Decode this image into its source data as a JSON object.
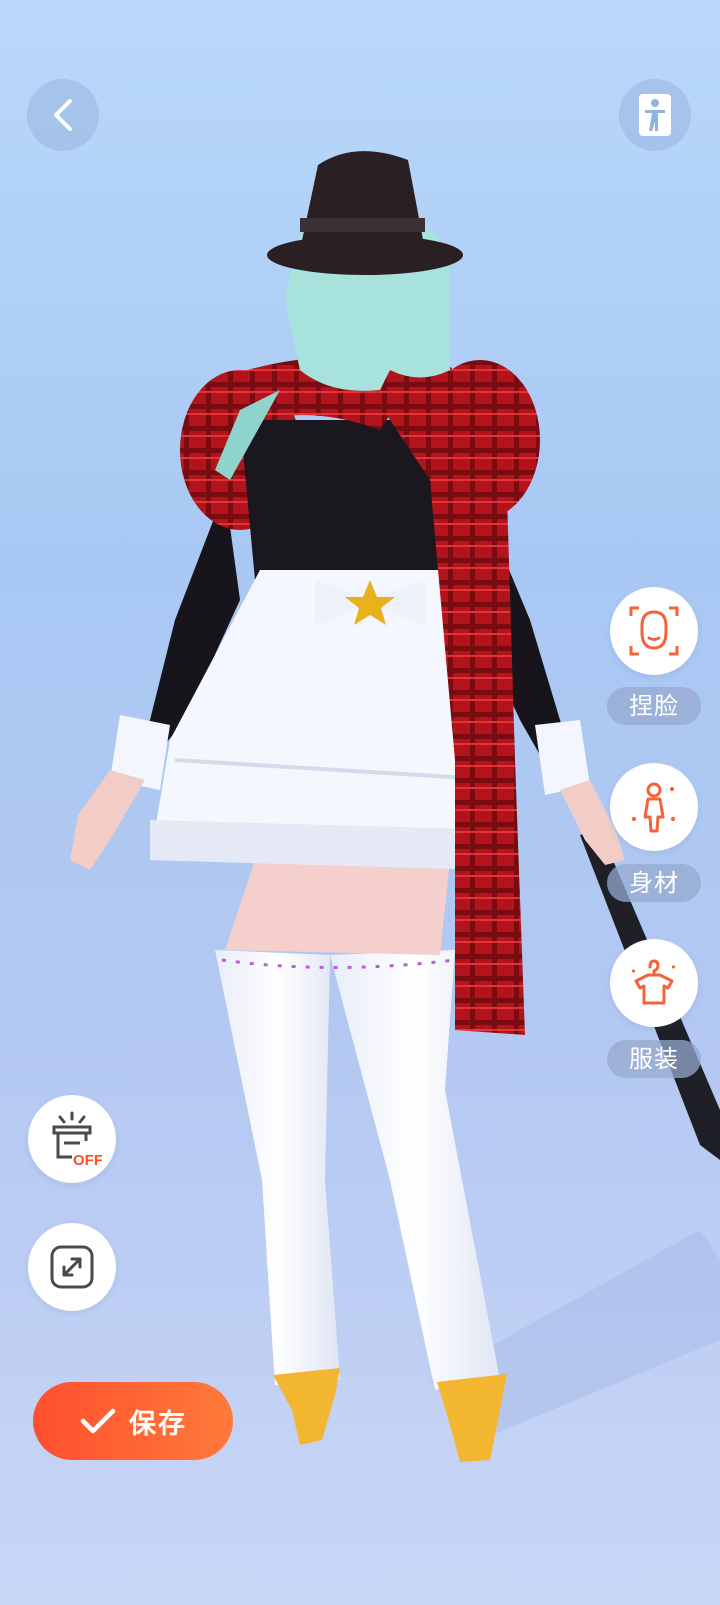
{
  "header": {
    "back_icon": "chevron-left-icon",
    "accessibility_icon": "person-standing-icon"
  },
  "side_menu": [
    {
      "label": "捏脸",
      "icon": "face-outline-icon"
    },
    {
      "label": "身材",
      "icon": "body-figure-icon"
    },
    {
      "label": "服装",
      "icon": "hanger-shirt-icon"
    }
  ],
  "tools": {
    "light_badge": "OFF",
    "light_icon": "lamp-off-icon",
    "expand_icon": "expand-arrows-icon"
  },
  "save_button": {
    "label": "保存",
    "icon": "check-icon"
  },
  "colors": {
    "accent": "#ff5a2e",
    "icon_orange": "#f2643a",
    "background_top": "#b9d8fa",
    "background_bottom": "#cad6f6"
  }
}
